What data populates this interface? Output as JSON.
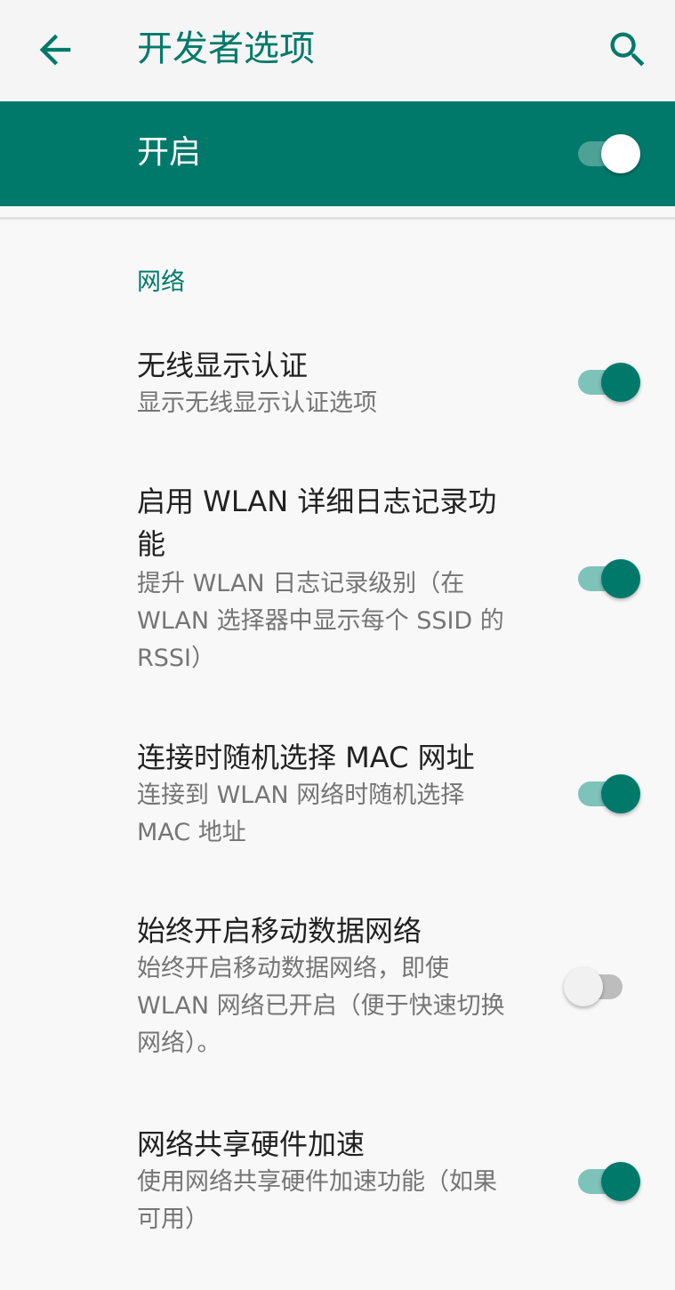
{
  "header": {
    "title": "开发者选项",
    "back_icon": "arrow-back-icon",
    "search_icon": "search-icon"
  },
  "master_switch": {
    "label": "开启",
    "checked": true
  },
  "section": {
    "title": "网络"
  },
  "items": [
    {
      "title": "无线显示认证",
      "summary": "显示无线显示认证选项",
      "checked": true
    },
    {
      "title": "启用 WLAN 详细日志记录功能",
      "summary": "提升 WLAN 日志记录级别（在 WLAN 选择器中显示每个 SSID 的 RSSI）",
      "checked": true
    },
    {
      "title": "连接时随机选择 MAC 网址",
      "summary": "连接到 WLAN 网络时随机选择 MAC 地址",
      "checked": true
    },
    {
      "title": "始终开启移动数据网络",
      "summary": "始终开启移动数据网络，即使 WLAN 网络已开启（便于快速切换网络）。",
      "checked": false
    },
    {
      "title": "网络共享硬件加速",
      "summary": "使用网络共享硬件加速功能（如果可用）",
      "checked": true
    }
  ],
  "colors": {
    "accent": "#00796b",
    "master_bar": "#00796b",
    "track_on": "#7ec3ba",
    "track_off": "#bdbdbd",
    "background": "#f8f8f8"
  }
}
